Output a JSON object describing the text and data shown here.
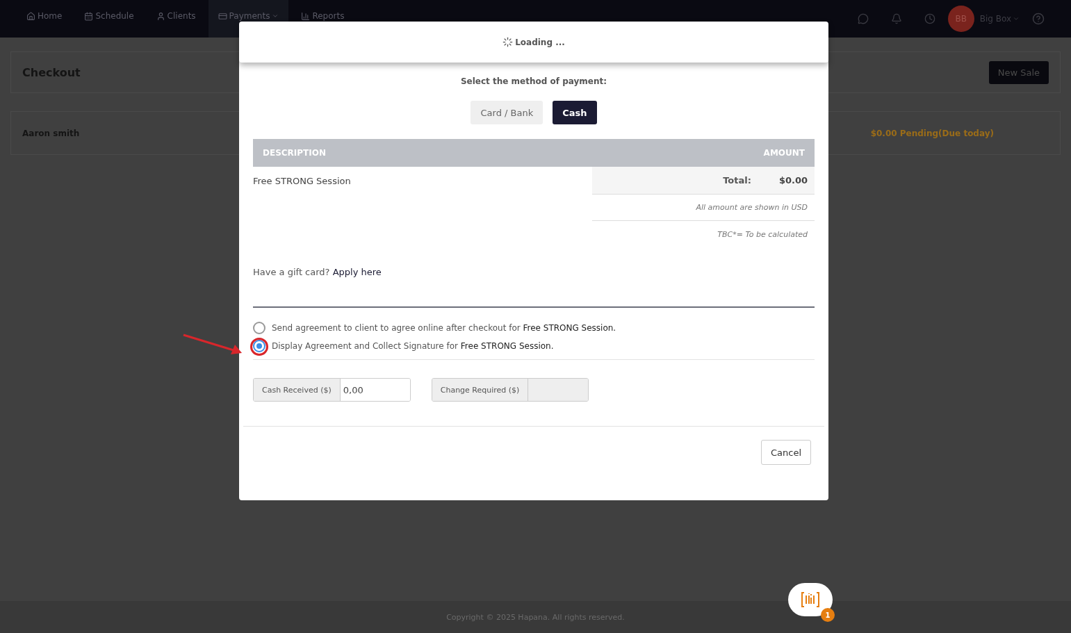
{
  "nav": {
    "items": [
      {
        "label": "Home",
        "selected": false,
        "dropdown": false
      },
      {
        "label": "Schedule",
        "selected": false,
        "dropdown": false
      },
      {
        "label": "Clients",
        "selected": false,
        "dropdown": false
      },
      {
        "label": "Payments",
        "selected": true,
        "dropdown": true
      },
      {
        "label": "Reports",
        "selected": false,
        "dropdown": false
      }
    ],
    "user": {
      "initials": "BB",
      "name": "Big Box"
    }
  },
  "page": {
    "title": "Checkout",
    "new_sale": "New Sale",
    "client": "Aaron smith",
    "pending": "$0.00 Pending(Due today)"
  },
  "modal": {
    "loading": "Loading ...",
    "prompt": "Select the method of payment:",
    "methods": [
      {
        "label": "Card / Bank",
        "selected": false
      },
      {
        "label": "Cash",
        "selected": true
      }
    ],
    "columns": [
      "DESCRIPTION",
      "AMOUNT"
    ],
    "item": "Free STRONG Session",
    "total_label": "Total:",
    "total_value": "$0.00",
    "notes": [
      "All amount are shown in USD",
      "TBC*= To be calculated"
    ],
    "gift_prompt": "Have a gift card?",
    "gift_link": "Apply here",
    "agreements": [
      {
        "text": "Send agreement to client to agree online after checkout for",
        "item": "Free STRONG Session.",
        "selected": false
      },
      {
        "text": "Display Agreement and Collect Signature for",
        "item": "Free STRONG Session.",
        "selected": true
      }
    ],
    "cash_received": {
      "label": "Cash Received ($)",
      "value": "0,00"
    },
    "change_required": {
      "label": "Change Required ($)"
    },
    "cancel": "Cancel"
  },
  "footer": "Copyright © 2025 Hapana. All rights reserved.",
  "scan_badge": "1"
}
